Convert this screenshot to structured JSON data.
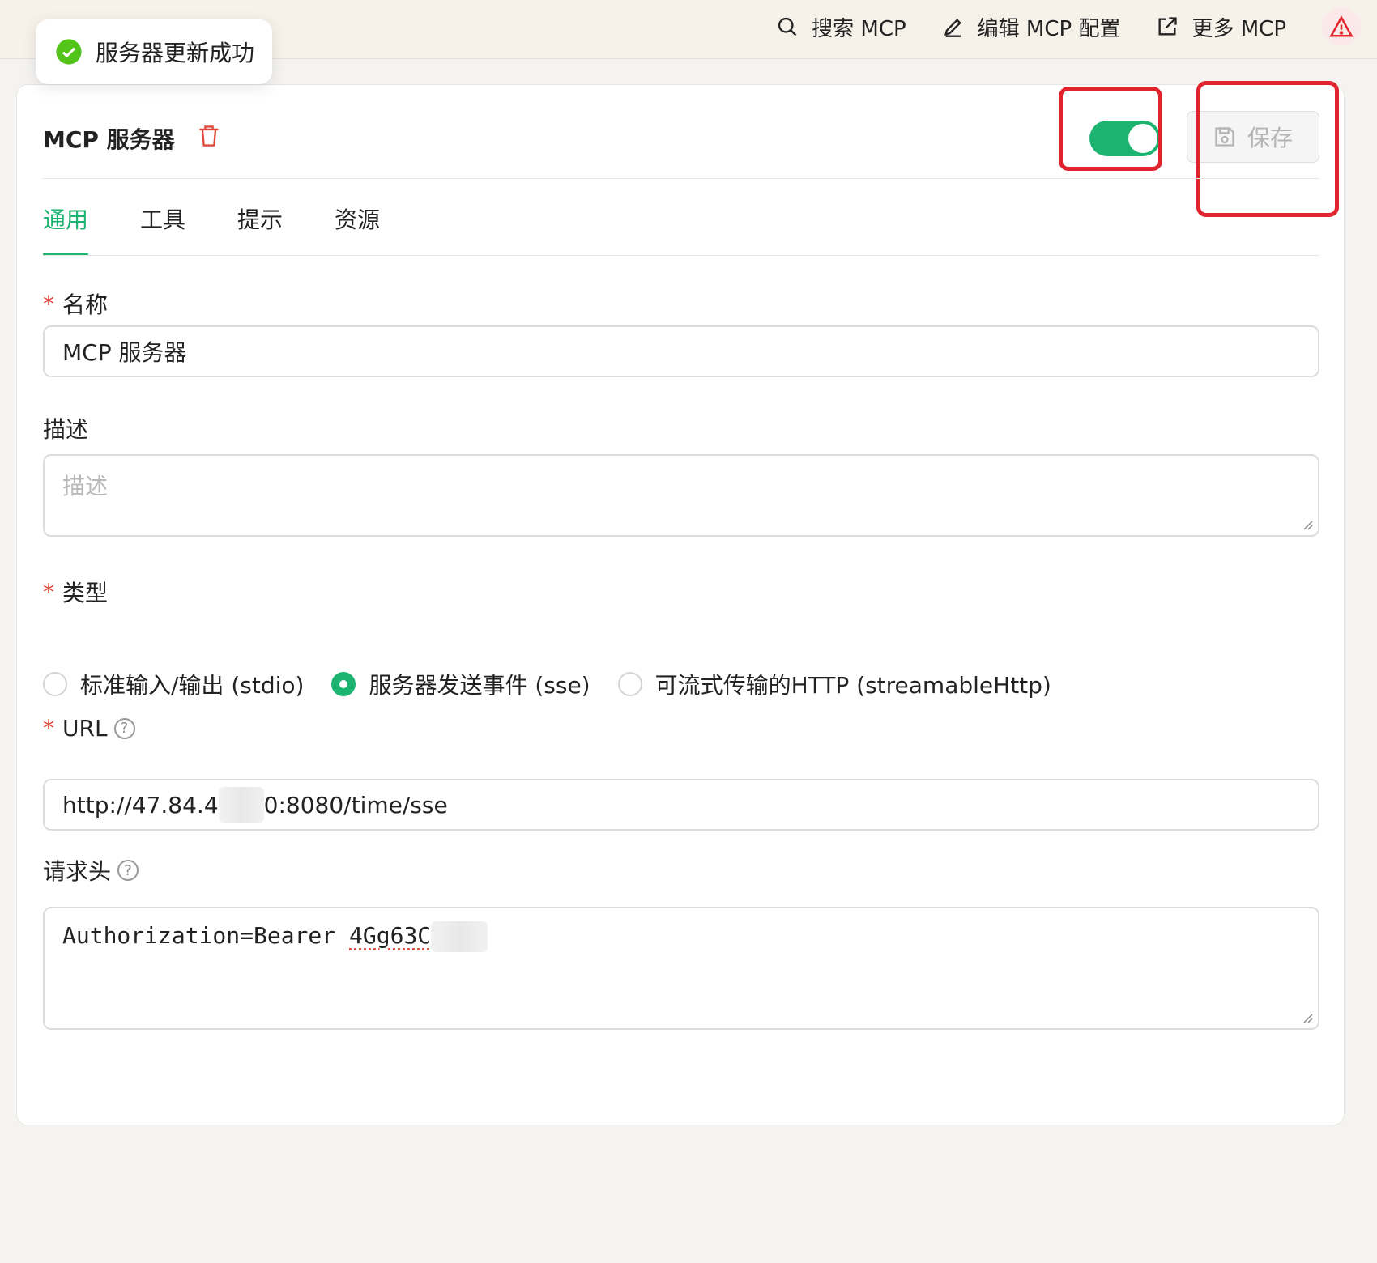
{
  "topbar": {
    "actions": [
      {
        "label": "搜索 MCP",
        "icon": "search-icon"
      },
      {
        "label": "编辑 MCP 配置",
        "icon": "pencil-icon"
      },
      {
        "label": "更多 MCP",
        "icon": "external-link-icon"
      }
    ],
    "warning_icon": "warning-icon"
  },
  "toast": {
    "message": "服务器更新成功",
    "icon": "check-circle-icon",
    "color": "#52c41a"
  },
  "card": {
    "title": "MCP 服务器",
    "delete_icon": "trash-icon",
    "enabled": true,
    "save_label": "保存",
    "save_icon": "floppy-disk-icon"
  },
  "tabs": [
    {
      "label": "通用",
      "active": true
    },
    {
      "label": "工具",
      "active": false
    },
    {
      "label": "提示",
      "active": false
    },
    {
      "label": "资源",
      "active": false
    }
  ],
  "form": {
    "required_mark": "*",
    "name": {
      "label": "名称",
      "value": "MCP 服务器",
      "required": true
    },
    "description": {
      "label": "描述",
      "placeholder": "描述",
      "value": ""
    },
    "type": {
      "label": "类型",
      "required": true,
      "options": [
        {
          "label": "标准输入/输出 (stdio)",
          "checked": false
        },
        {
          "label": "服务器发送事件 (sse)",
          "checked": true
        },
        {
          "label": "可流式传输的HTTP (streamableHttp)",
          "checked": false
        }
      ]
    },
    "url": {
      "label": "URL",
      "value_prefix": "http://47.84.4",
      "value_suffix": "0:8080/time/sse",
      "required": true
    },
    "headers": {
      "label": "请求头",
      "value_prefix": "Authorization=Bearer ",
      "value_token": "4Gg63C"
    }
  },
  "colors": {
    "accent": "#1db370",
    "highlight": "#e0232d",
    "danger": "#e0473d"
  }
}
